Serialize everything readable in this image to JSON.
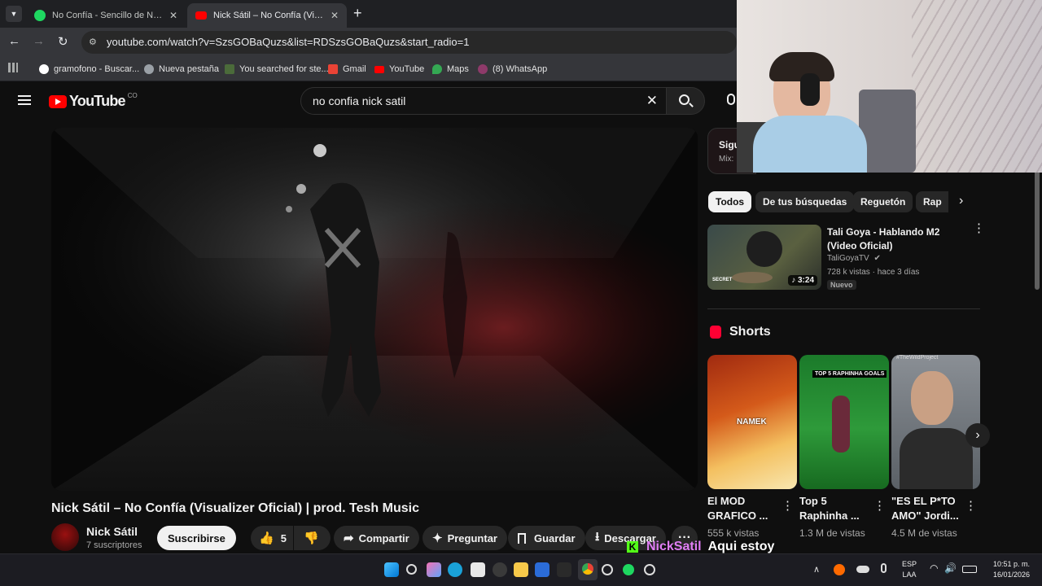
{
  "browser": {
    "tabs": [
      {
        "label": "No Confía - Sencillo de Nick Sátil"
      },
      {
        "label": "Nick Sátil – No Confía (Visualizer Oficial)"
      }
    ],
    "url": "youtube.com/watch?v=SzsGOBaQuzs&list=RDSzsGOBaQuzs&start_radio=1",
    "bookmarks": [
      {
        "label": "gramofono - Buscar..."
      },
      {
        "label": "Nueva pestaña"
      },
      {
        "label": "You searched for ste..."
      },
      {
        "label": "Gmail"
      },
      {
        "label": "YouTube"
      },
      {
        "label": "Maps"
      },
      {
        "label": "(8) WhatsApp"
      }
    ]
  },
  "youtube": {
    "logo_text": "YouTube",
    "country_code": "CO",
    "search_value": "no confia nick satil",
    "video": {
      "title": "Nick Sátil – No Confía (Visualizer Oficial) | prod. Tesh Music",
      "channel": "Nick Sátil",
      "subscribers": "7 suscriptores",
      "subscribe_label": "Suscribirse",
      "likes": "5",
      "share_label": "Compartir",
      "ask_label": "Preguntar",
      "save_label": "Guardar",
      "download_label": "Descargar"
    },
    "playlist": {
      "title": "Sigu",
      "subtitle": "Mix:"
    },
    "chips": [
      "Todos",
      "De tus búsquedas",
      "Reguetón",
      "Rap"
    ],
    "recommended": {
      "title": "Tali Goya - Hablando M2 (Video Oficial)",
      "channel": "TaliGoyaTV",
      "meta": "728 k vistas · hace 3 días",
      "badge": "Nuevo",
      "duration": "3:24",
      "thumb_text": "SECRET"
    },
    "shorts_heading": "Shorts",
    "shorts": [
      {
        "title": "El MOD GRAFICO ...",
        "views": "555 k vistas",
        "overlay": "NAMEK"
      },
      {
        "title": "Top 5 Raphinha ...",
        "views": "1.3 M de vistas",
        "overlay": "TOP 5 RAPHINHA GOALS"
      },
      {
        "title": "\"ES EL P*TO AMO\" Jordi...",
        "views": "4.5 M de vistas",
        "overlay": "#TheWildProject"
      }
    ]
  },
  "overlay": {
    "name": "NickSatil",
    "message": "Aqui estoy"
  },
  "taskbar": {
    "lang": "ESP",
    "lang2": "LAA",
    "time": "10:51 p. m.",
    "date": "16/01/2026"
  }
}
